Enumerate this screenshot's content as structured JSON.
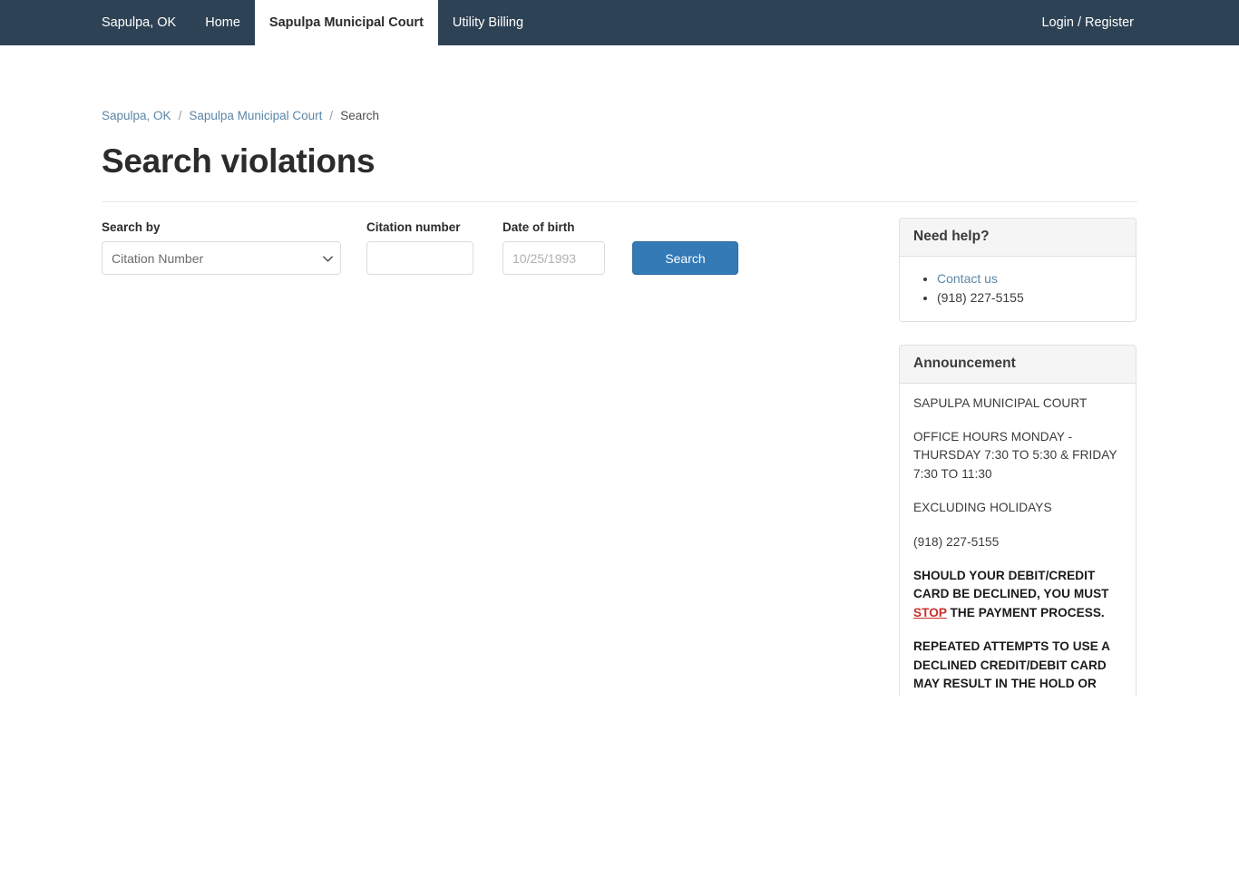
{
  "navbar": {
    "brand_color": "#2d4254",
    "left_items": [
      {
        "label": "Sapulpa, OK",
        "active": false
      },
      {
        "label": "Home",
        "active": false
      },
      {
        "label": "Sapulpa Municipal Court",
        "active": true
      },
      {
        "label": "Utility Billing",
        "active": false
      }
    ],
    "right_items": [
      {
        "label": "Login / Register"
      }
    ]
  },
  "breadcrumb": {
    "item1": "Sapulpa, OK",
    "sep1": "/",
    "item2": "Sapulpa Municipal Court",
    "sep2": "/",
    "current": "Search"
  },
  "page": {
    "title": "Search violations"
  },
  "search_form": {
    "search_by_label": "Search by",
    "search_by_value": "Citation Number",
    "search_by_options": [
      "Citation Number"
    ],
    "citation_label": "Citation number",
    "citation_value": "",
    "citation_placeholder": "",
    "dob_label": "Date of birth",
    "dob_value": "",
    "dob_placeholder": "10/25/1993",
    "search_button": "Search",
    "search_button_color": "#337ab7"
  },
  "help_panel": {
    "title": "Need help?",
    "contact_link": "Contact us",
    "phone": "(918) 227-5155"
  },
  "announcement_panel": {
    "title": "Announcement",
    "paragraphs": [
      "SAPULPA MUNICIPAL COURT",
      "OFFICE HOURS MONDAY - THURSDAY 7:30 TO 5:30 & FRIDAY 7:30 TO 11:30",
      "EXCLUDING HOLIDAYS",
      "(918) 227-5155"
    ],
    "bold_block_1_before": "SHOULD YOUR DEBIT/CREDIT CARD BE DECLINED, YOU MUST ",
    "bold_block_1_link": "STOP",
    "bold_block_1_after": " THE PAYMENT PROCESS.",
    "bold_block_2": "REPEATED ATTEMPTS TO USE A DECLINED CREDIT/DEBIT CARD MAY RESULT IN THE HOLD OR OVERDRAFT OF YOUR BANK /CREDIT CARD ACCOUNT.  CARD HOLDERS SHOULD CONTACT THEIR BANK OR CREDIT CARD COMPANY.  THE CITY OF SAPULPA",
    "stop_link_color": "#c9302c"
  }
}
